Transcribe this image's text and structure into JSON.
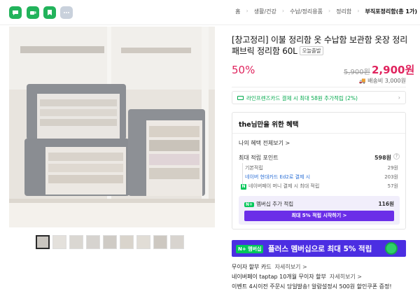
{
  "topbar": {
    "icons": [
      "chat-icon",
      "coffee-icon",
      "bookmark-icon",
      "more-icon"
    ],
    "breadcrumbs": [
      "홈",
      "생활/건강",
      "수납/정리용품",
      "정리함",
      "부직포정리함(총 1가)"
    ]
  },
  "product": {
    "title": "[창고정리] 이불 정리함 옷 수납함 보관함 옷장 정리 패브릭 정리함 60L",
    "badge": "오늘출발",
    "discount": "50%",
    "original_price": "5,900원",
    "price": "2,900원",
    "shipping": "배송비 3,000원"
  },
  "card_promo": {
    "text": "라인프렌즈카드 결제 시 최대 58원 추가적립 (2%)",
    "brand": "라인프렌즈카드"
  },
  "benefit": {
    "title": "the님만을 위한 혜택",
    "my_benefits": "나의 혜택 전체보기 >",
    "max_points_label": "최대 적립 포인트",
    "max_points_value": "598원",
    "help": "?",
    "rows": [
      {
        "label": "기본적립",
        "value": "29원"
      },
      {
        "label": "네이버 현대카드 Ed2로 결제 시",
        "value": "203원"
      },
      {
        "label": "네이버페이 머니 결제 시 최대 적립",
        "value": "57원"
      }
    ],
    "membership_label": "멤버십 추가 적립",
    "membership_badge": "N+",
    "membership_value": "116원",
    "membership_button": "최대 5% 적립 시작하기 >"
  },
  "banner": {
    "badge": "N+ 멤버십",
    "text": "플러스 멤버십으로 최대 5% 적립"
  },
  "extras": [
    {
      "label": "무이자 할부 카드",
      "more": "자세히보기 >"
    },
    {
      "label": "네이버페이 taptap 10개월 무이자 할부",
      "more": "자세히보기 >"
    },
    {
      "label": "이벤트   4시이전 주문시 당일발송! 알람설정시 500원 할인쿠폰 증정!",
      "more": ""
    }
  ],
  "colors": {
    "accent": "#e0245e",
    "naver_green": "#03c75a",
    "purple": "#6b2ee8",
    "banner": "#4b2ee2"
  }
}
